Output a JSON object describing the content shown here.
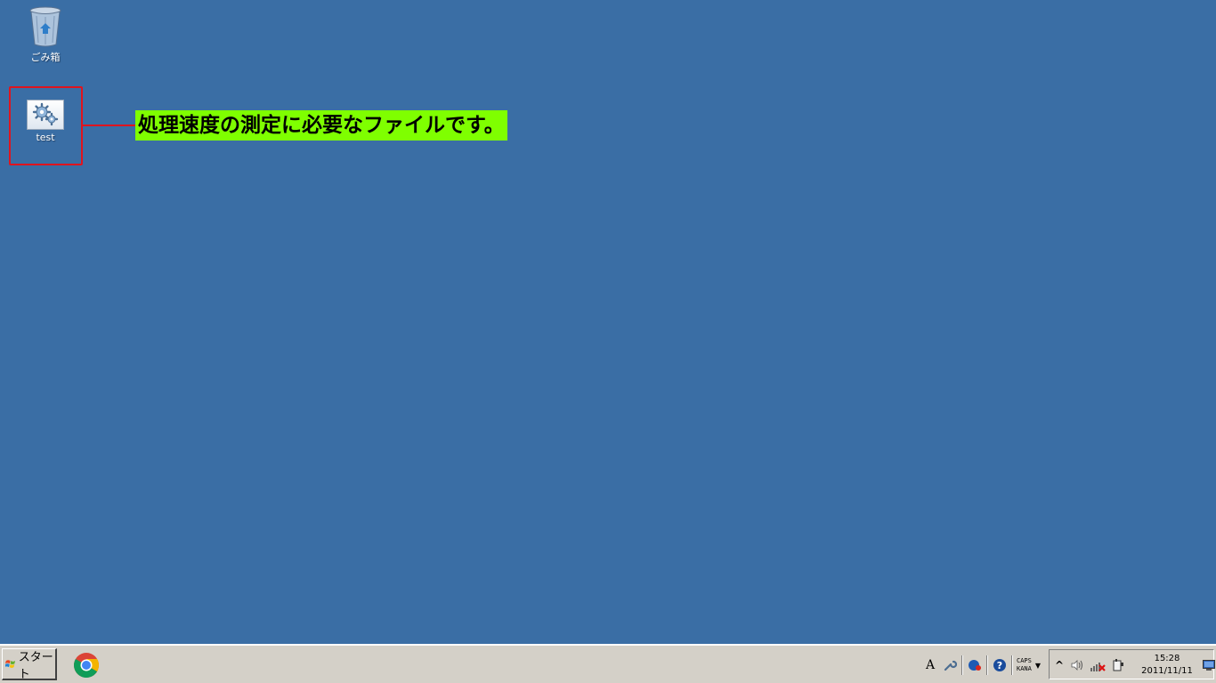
{
  "desktop": {
    "background": "#3a6ea5",
    "icons": [
      {
        "label": "ごみ箱",
        "icon": "recycle-bin-icon"
      },
      {
        "label": "test",
        "icon": "settings-file-icon"
      }
    ]
  },
  "annotation": {
    "text": "処理速度の測定に必要なファイルです。",
    "highlight_color": "#7fff00",
    "border_color": "#e0141e"
  },
  "taskbar": {
    "start_label": "スタート",
    "pinned": [
      {
        "name": "chrome-icon"
      }
    ],
    "tray": {
      "ime_letter": "A",
      "ime_caps": "CAPS",
      "ime_kana": "KANA",
      "expand_symbol": "^",
      "icons": [
        "language-bar-icon",
        "tools-icon",
        "network-app-icon",
        "help-icon",
        "expand-icon",
        "volume-icon",
        "network-disconnected-icon",
        "power-icon",
        "show-desktop-icon"
      ]
    },
    "clock": {
      "time": "15:28",
      "date": "2011/11/11"
    }
  }
}
